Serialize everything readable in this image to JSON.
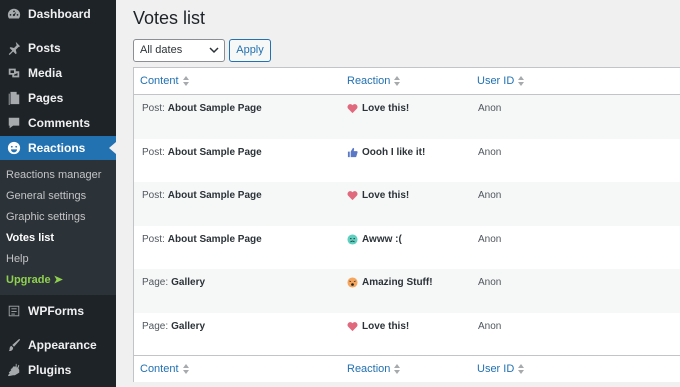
{
  "sidebar": {
    "items_top": [
      {
        "label": "Dashboard",
        "icon": "dashboard-icon"
      },
      {
        "label": "Posts",
        "icon": "pin-icon"
      },
      {
        "label": "Media",
        "icon": "media-icon"
      },
      {
        "label": "Pages",
        "icon": "pages-icon"
      },
      {
        "label": "Comments",
        "icon": "comment-icon"
      },
      {
        "label": "Reactions",
        "icon": "reactions-icon"
      }
    ],
    "submenu": [
      "Reactions manager",
      "General settings",
      "Graphic settings",
      "Votes list",
      "Help",
      "Upgrade ➤"
    ],
    "items_bottom": [
      {
        "label": "WPForms",
        "icon": "wpforms-icon"
      },
      {
        "label": "Appearance",
        "icon": "brush-icon"
      },
      {
        "label": "Plugins",
        "icon": "plugin-icon"
      }
    ],
    "accent": "#2271b1",
    "upgrade_color": "#8fd14f"
  },
  "main": {
    "title": "Votes list",
    "filter": {
      "selected": "All dates"
    },
    "apply_label": "Apply",
    "columns": [
      "Content",
      "Reaction",
      "User ID"
    ],
    "rows": [
      {
        "type": "Post:",
        "title": "About Sample Page",
        "reaction": "Love this!",
        "icon": "heart-icon",
        "user": "Anon"
      },
      {
        "type": "Post:",
        "title": "About Sample Page",
        "reaction": "Oooh I like it!",
        "icon": "thumbs-up-icon",
        "user": "Anon"
      },
      {
        "type": "Post:",
        "title": "About Sample Page",
        "reaction": "Love this!",
        "icon": "heart-icon",
        "user": "Anon"
      },
      {
        "type": "Post:",
        "title": "About Sample Page",
        "reaction": "Awww :(",
        "icon": "sad-face-icon",
        "user": "Anon"
      },
      {
        "type": "Page:",
        "title": "Gallery",
        "reaction": "Amazing Stuff!",
        "icon": "wow-face-icon",
        "user": "Anon"
      },
      {
        "type": "Page:",
        "title": "Gallery",
        "reaction": "Love this!",
        "icon": "heart-icon",
        "user": "Anon"
      }
    ]
  }
}
